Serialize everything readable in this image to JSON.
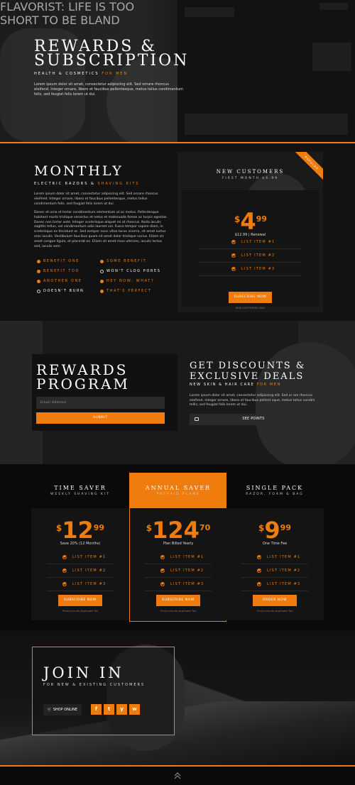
{
  "colors": {
    "accent": "#f07c0d",
    "background": "#0b0b0b"
  },
  "hero": {
    "title_line1": "REWARDS &",
    "title_line2": "SUBSCRIPTION",
    "subtitle_prefix": "HEALTH & COSMETICS",
    "subtitle_accent": "FOR MEN",
    "text": "Lorem ipsum dolor sit amet, consectetur adipiscing elit. Sed ornare rhoncus eleifend. Integer ornare, libero et faucibus pellentesque, metus tellus condimentum felis, sed feugiat felis lorem ut dui.",
    "bg_text_line1": "FLAVORIST: LIFE IS TOO",
    "bg_text_line2": "SHORT TO BE BLAND"
  },
  "monthly": {
    "title": "MONTHLY",
    "subtitle_prefix": "ELECTRIC RAZORS &",
    "subtitle_accent": "SHAVING KITS",
    "para1": "Lorem ipsum dolor sit amet, consectetur adipiscing elit. Sed ornare rhoncus eleifend. Integer ornare, libero et faucibus pellentesque, metus tellus condimentum felis, sed feugiat felis lorem ut dui.",
    "para2": "Donec et urna et tortor condimentum elementum ut ac metus. Pellentesque habitant morbi tristique senectus et netus et malesuada fames ac turpis egestas. Donec non tortor ante. Integer scelerisque aliquet mi at rhoncus. Nulla iaculis sagittis tellus, vel condimentum odio laoreet vel. Fusce tempor sapien diam, in scelerisque ex tincidunt ac. Sed semper nunc vitae lacus viverra, sit amet luctus eros iaculis. Vestibulum faucibus quam sit amet dolor tristique varius. Etiam sit amet congue ligula, et placerat ex. Etiam sit amet risus ultricies, iaculis lectus sed, iaculis sem.",
    "features": [
      {
        "label": "BENEFIT ONE",
        "highlight": true
      },
      {
        "label": "SOME BENEFIT",
        "highlight": true
      },
      {
        "label": "BENEFIT TOO",
        "highlight": true
      },
      {
        "label": "WON'T CLOG PORES",
        "highlight": false
      },
      {
        "label": "ANOTHER ONE",
        "highlight": true
      },
      {
        "label": "HEY NOW, WHAT?",
        "highlight": true
      },
      {
        "label": "DOESN'T BURN",
        "highlight": false
      },
      {
        "label": "THAT'S PERFECT",
        "highlight": true
      }
    ],
    "card": {
      "ribbon": "POPULAR",
      "title": "NEW CUSTOMERS",
      "subtitle": "FIRST MONTH $4.99",
      "currency": "$",
      "price_whole": "4",
      "price_cents": "99",
      "renewal": "$12.99 | Renewal",
      "items": [
        "LIST ITEM #1",
        "LIST ITEM #2",
        "LIST ITEM #3"
      ],
      "button": "SUBSCRIBE NOW",
      "fine_print": "NEW CUSTOMERS ONLY"
    }
  },
  "rewards": {
    "title_line1": "REWARDS",
    "title_line2": "PROGRAM",
    "email_placeholder": "Email Address",
    "submit": "SUBMIT",
    "discount_title_line1": "GET DISCOUNTS &",
    "discount_title_line2": "EXCLUSIVE DEALS",
    "discount_sub_prefix": "NEW SKIN & HAIR CARE",
    "discount_sub_accent": "FOR MEN",
    "discount_text": "Lorem ipsum dolor sit amet, consectetur adipiscing elit. Sed or are rhoncus eleifend. Integer ornare, libero et faucibus pellent sque, metus tellus condim tellis, sed feugiat felis lorem ut dui.",
    "see_points": "SEE POINTS"
  },
  "pricing": {
    "plans": [
      {
        "title": "TIME SAVER",
        "subtitle": "WEEKLY SHAVING KIT",
        "currency": "$",
        "whole": "12",
        "cents": "99",
        "note": "Save 20% (12 Months)",
        "items": [
          "LIST ITEM #1",
          "LIST ITEM #2",
          "LIST ITEM #3"
        ],
        "button": "SUBSCRIBE NOW",
        "fine": "Prices Include Applicable Tax"
      },
      {
        "title": "ANNUAL SAVER",
        "subtitle": "PREPAID PLANS",
        "currency": "$",
        "whole": "124",
        "cents": "70",
        "note": "Plan Billed Yearly",
        "items": [
          "LIST ITEM #1",
          "LIST ITEM #2",
          "LIST ITEM #3"
        ],
        "button": "SUBSCRIBE NOW",
        "fine": "Prices Include Applicable Tax"
      },
      {
        "title": "SINGLE PACK",
        "subtitle": "RAZOR, FOAM & BAG",
        "currency": "$",
        "whole": "9",
        "cents": "99",
        "note": "One Time Fee",
        "items": [
          "LIST ITEM #1",
          "LIST ITEM #2",
          "LIST ITEM #3"
        ],
        "button": "ORDER NOW",
        "fine": "Prices Include Applicable Tax"
      }
    ]
  },
  "join": {
    "title": "JOIN IN",
    "subtitle": "FOR NEW & EXISTING CUSTOMERS",
    "shop_button": "SHOP ONLINE",
    "social": [
      {
        "icon": "facebook-icon",
        "glyph": "f"
      },
      {
        "icon": "twitter-icon",
        "glyph": "t"
      },
      {
        "icon": "yelp-icon",
        "glyph": "y"
      },
      {
        "icon": "whatsapp-icon",
        "glyph": "w"
      }
    ]
  },
  "footer": {
    "icon": "double-chevron-up-icon"
  }
}
